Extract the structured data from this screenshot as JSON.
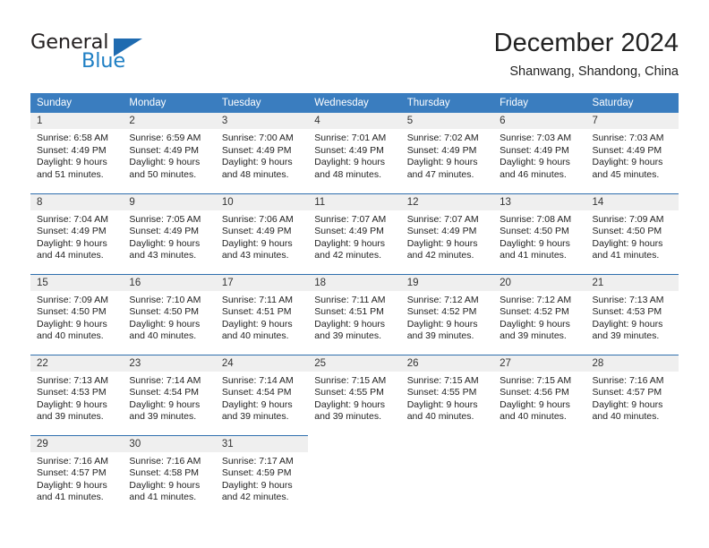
{
  "brand": {
    "name_part1": "General",
    "name_part2": "Blue",
    "accent_color": "#1f7fc4"
  },
  "header": {
    "title": "December 2024",
    "subtitle": "Shanwang, Shandong, China"
  },
  "calendar": {
    "header_bg": "#3a7dbf",
    "divider_color": "#2f6fae",
    "daynum_bg": "#efefef",
    "weekdays": [
      "Sunday",
      "Monday",
      "Tuesday",
      "Wednesday",
      "Thursday",
      "Friday",
      "Saturday"
    ],
    "weeks": [
      [
        {
          "day": "1",
          "sunrise": "Sunrise: 6:58 AM",
          "sunset": "Sunset: 4:49 PM",
          "daylight_line1": "Daylight: 9 hours",
          "daylight_line2": "and 51 minutes."
        },
        {
          "day": "2",
          "sunrise": "Sunrise: 6:59 AM",
          "sunset": "Sunset: 4:49 PM",
          "daylight_line1": "Daylight: 9 hours",
          "daylight_line2": "and 50 minutes."
        },
        {
          "day": "3",
          "sunrise": "Sunrise: 7:00 AM",
          "sunset": "Sunset: 4:49 PM",
          "daylight_line1": "Daylight: 9 hours",
          "daylight_line2": "and 48 minutes."
        },
        {
          "day": "4",
          "sunrise": "Sunrise: 7:01 AM",
          "sunset": "Sunset: 4:49 PM",
          "daylight_line1": "Daylight: 9 hours",
          "daylight_line2": "and 48 minutes."
        },
        {
          "day": "5",
          "sunrise": "Sunrise: 7:02 AM",
          "sunset": "Sunset: 4:49 PM",
          "daylight_line1": "Daylight: 9 hours",
          "daylight_line2": "and 47 minutes."
        },
        {
          "day": "6",
          "sunrise": "Sunrise: 7:03 AM",
          "sunset": "Sunset: 4:49 PM",
          "daylight_line1": "Daylight: 9 hours",
          "daylight_line2": "and 46 minutes."
        },
        {
          "day": "7",
          "sunrise": "Sunrise: 7:03 AM",
          "sunset": "Sunset: 4:49 PM",
          "daylight_line1": "Daylight: 9 hours",
          "daylight_line2": "and 45 minutes."
        }
      ],
      [
        {
          "day": "8",
          "sunrise": "Sunrise: 7:04 AM",
          "sunset": "Sunset: 4:49 PM",
          "daylight_line1": "Daylight: 9 hours",
          "daylight_line2": "and 44 minutes."
        },
        {
          "day": "9",
          "sunrise": "Sunrise: 7:05 AM",
          "sunset": "Sunset: 4:49 PM",
          "daylight_line1": "Daylight: 9 hours",
          "daylight_line2": "and 43 minutes."
        },
        {
          "day": "10",
          "sunrise": "Sunrise: 7:06 AM",
          "sunset": "Sunset: 4:49 PM",
          "daylight_line1": "Daylight: 9 hours",
          "daylight_line2": "and 43 minutes."
        },
        {
          "day": "11",
          "sunrise": "Sunrise: 7:07 AM",
          "sunset": "Sunset: 4:49 PM",
          "daylight_line1": "Daylight: 9 hours",
          "daylight_line2": "and 42 minutes."
        },
        {
          "day": "12",
          "sunrise": "Sunrise: 7:07 AM",
          "sunset": "Sunset: 4:49 PM",
          "daylight_line1": "Daylight: 9 hours",
          "daylight_line2": "and 42 minutes."
        },
        {
          "day": "13",
          "sunrise": "Sunrise: 7:08 AM",
          "sunset": "Sunset: 4:50 PM",
          "daylight_line1": "Daylight: 9 hours",
          "daylight_line2": "and 41 minutes."
        },
        {
          "day": "14",
          "sunrise": "Sunrise: 7:09 AM",
          "sunset": "Sunset: 4:50 PM",
          "daylight_line1": "Daylight: 9 hours",
          "daylight_line2": "and 41 minutes."
        }
      ],
      [
        {
          "day": "15",
          "sunrise": "Sunrise: 7:09 AM",
          "sunset": "Sunset: 4:50 PM",
          "daylight_line1": "Daylight: 9 hours",
          "daylight_line2": "and 40 minutes."
        },
        {
          "day": "16",
          "sunrise": "Sunrise: 7:10 AM",
          "sunset": "Sunset: 4:50 PM",
          "daylight_line1": "Daylight: 9 hours",
          "daylight_line2": "and 40 minutes."
        },
        {
          "day": "17",
          "sunrise": "Sunrise: 7:11 AM",
          "sunset": "Sunset: 4:51 PM",
          "daylight_line1": "Daylight: 9 hours",
          "daylight_line2": "and 40 minutes."
        },
        {
          "day": "18",
          "sunrise": "Sunrise: 7:11 AM",
          "sunset": "Sunset: 4:51 PM",
          "daylight_line1": "Daylight: 9 hours",
          "daylight_line2": "and 39 minutes."
        },
        {
          "day": "19",
          "sunrise": "Sunrise: 7:12 AM",
          "sunset": "Sunset: 4:52 PM",
          "daylight_line1": "Daylight: 9 hours",
          "daylight_line2": "and 39 minutes."
        },
        {
          "day": "20",
          "sunrise": "Sunrise: 7:12 AM",
          "sunset": "Sunset: 4:52 PM",
          "daylight_line1": "Daylight: 9 hours",
          "daylight_line2": "and 39 minutes."
        },
        {
          "day": "21",
          "sunrise": "Sunrise: 7:13 AM",
          "sunset": "Sunset: 4:53 PM",
          "daylight_line1": "Daylight: 9 hours",
          "daylight_line2": "and 39 minutes."
        }
      ],
      [
        {
          "day": "22",
          "sunrise": "Sunrise: 7:13 AM",
          "sunset": "Sunset: 4:53 PM",
          "daylight_line1": "Daylight: 9 hours",
          "daylight_line2": "and 39 minutes."
        },
        {
          "day": "23",
          "sunrise": "Sunrise: 7:14 AM",
          "sunset": "Sunset: 4:54 PM",
          "daylight_line1": "Daylight: 9 hours",
          "daylight_line2": "and 39 minutes."
        },
        {
          "day": "24",
          "sunrise": "Sunrise: 7:14 AM",
          "sunset": "Sunset: 4:54 PM",
          "daylight_line1": "Daylight: 9 hours",
          "daylight_line2": "and 39 minutes."
        },
        {
          "day": "25",
          "sunrise": "Sunrise: 7:15 AM",
          "sunset": "Sunset: 4:55 PM",
          "daylight_line1": "Daylight: 9 hours",
          "daylight_line2": "and 39 minutes."
        },
        {
          "day": "26",
          "sunrise": "Sunrise: 7:15 AM",
          "sunset": "Sunset: 4:55 PM",
          "daylight_line1": "Daylight: 9 hours",
          "daylight_line2": "and 40 minutes."
        },
        {
          "day": "27",
          "sunrise": "Sunrise: 7:15 AM",
          "sunset": "Sunset: 4:56 PM",
          "daylight_line1": "Daylight: 9 hours",
          "daylight_line2": "and 40 minutes."
        },
        {
          "day": "28",
          "sunrise": "Sunrise: 7:16 AM",
          "sunset": "Sunset: 4:57 PM",
          "daylight_line1": "Daylight: 9 hours",
          "daylight_line2": "and 40 minutes."
        }
      ],
      [
        {
          "day": "29",
          "sunrise": "Sunrise: 7:16 AM",
          "sunset": "Sunset: 4:57 PM",
          "daylight_line1": "Daylight: 9 hours",
          "daylight_line2": "and 41 minutes."
        },
        {
          "day": "30",
          "sunrise": "Sunrise: 7:16 AM",
          "sunset": "Sunset: 4:58 PM",
          "daylight_line1": "Daylight: 9 hours",
          "daylight_line2": "and 41 minutes."
        },
        {
          "day": "31",
          "sunrise": "Sunrise: 7:17 AM",
          "sunset": "Sunset: 4:59 PM",
          "daylight_line1": "Daylight: 9 hours",
          "daylight_line2": "and 42 minutes."
        },
        {
          "day": "",
          "sunrise": "",
          "sunset": "",
          "daylight_line1": "",
          "daylight_line2": ""
        },
        {
          "day": "",
          "sunrise": "",
          "sunset": "",
          "daylight_line1": "",
          "daylight_line2": ""
        },
        {
          "day": "",
          "sunrise": "",
          "sunset": "",
          "daylight_line1": "",
          "daylight_line2": ""
        },
        {
          "day": "",
          "sunrise": "",
          "sunset": "",
          "daylight_line1": "",
          "daylight_line2": ""
        }
      ]
    ]
  }
}
